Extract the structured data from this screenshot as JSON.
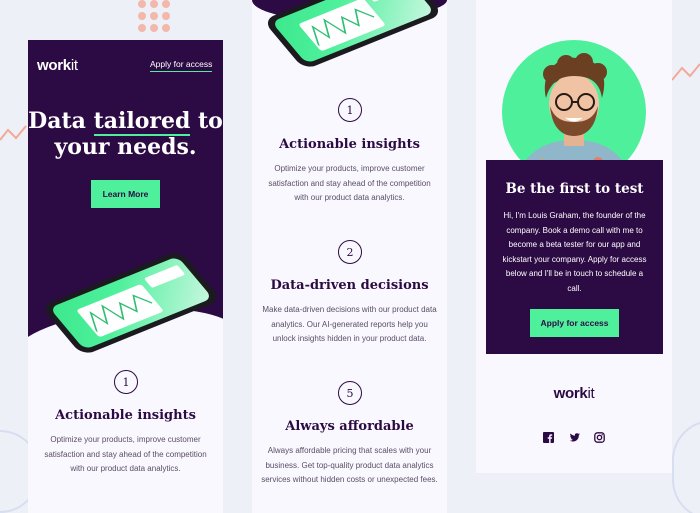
{
  "brand": {
    "logo_main": "work",
    "logo_suffix": "it",
    "colors": {
      "dark_purple": "#2c0a43",
      "accent_green": "#4ef09c",
      "background": "#eef0f7",
      "panel": "#f9f8fe",
      "text_gray": "#5a4e66"
    }
  },
  "panel1": {
    "header": {
      "apply_link": "Apply for access"
    },
    "hero": {
      "title_part1": "Data ",
      "title_highlight": "tailored",
      "title_part2": " to your needs.",
      "button_label": "Learn More"
    },
    "feature": {
      "number": "1",
      "title": "Actionable insights",
      "description": "Optimize your products, improve customer satisfaction and stay ahead of the competition with our product data analytics."
    }
  },
  "panel2": {
    "features": [
      {
        "number": "1",
        "title": "Actionable insights",
        "description": "Optimize your products, improve customer satisfaction and stay ahead of the competition with our product data analytics."
      },
      {
        "number": "2",
        "title": "Data-driven decisions",
        "description": "Make data-driven decisions with our product data analytics. Our AI-generated reports help you unlock insights hidden in your product data."
      },
      {
        "number": "5",
        "title": "Always affordable",
        "description": "Always affordable pricing that scales with your business. Get top-quality product data analytics services without hidden costs or unexpected fees."
      }
    ]
  },
  "panel3": {
    "cta": {
      "title": "Be the first to test",
      "description": "Hi, I'm Louis Graham, the founder of the company. Book a demo call with me to become a beta tester for our app and kickstart your company. Apply for access below and I'll be in touch to schedule a call.",
      "button_label": "Apply for access"
    },
    "socials": [
      "facebook-icon",
      "twitter-icon",
      "instagram-icon"
    ]
  }
}
